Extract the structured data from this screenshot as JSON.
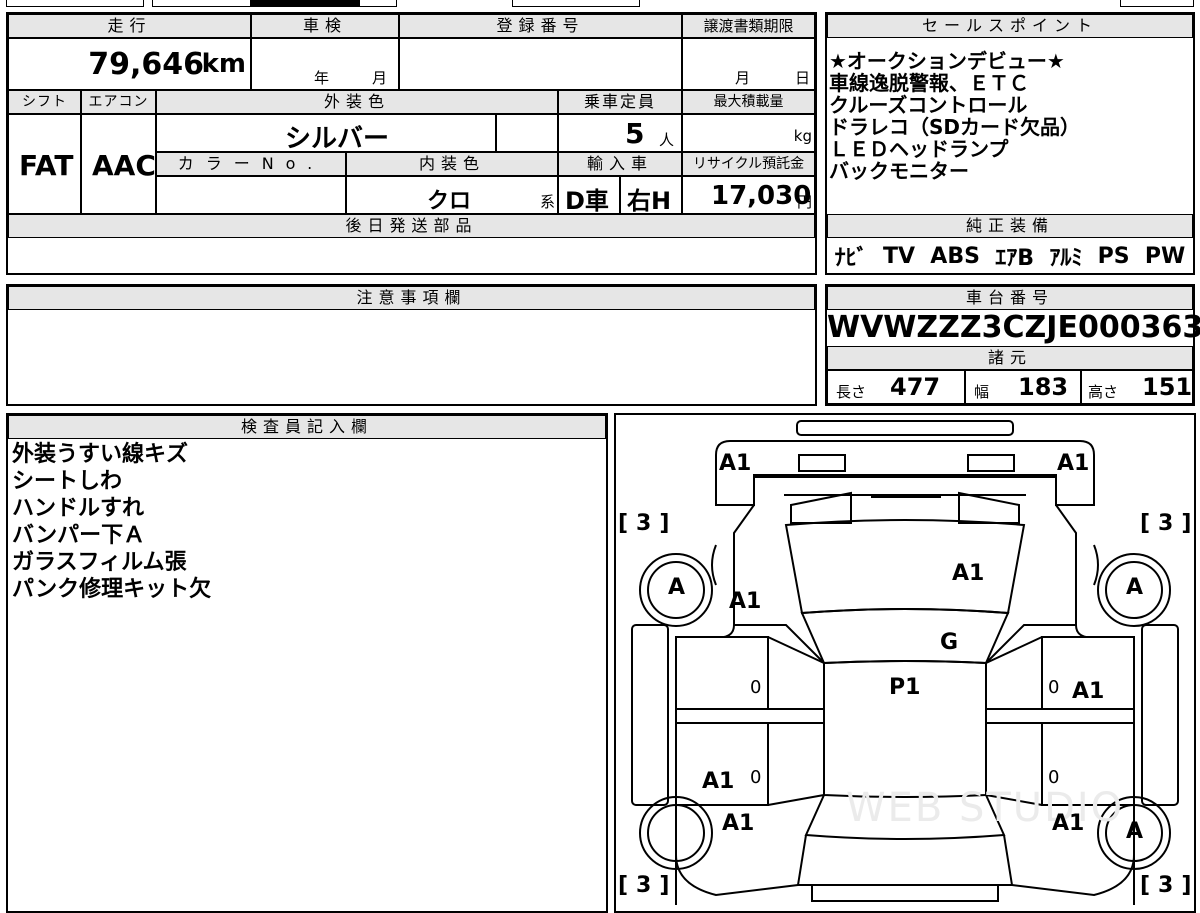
{
  "top_strip": {
    "fragment_1": "",
    "fragment_2": ""
  },
  "mileage": {
    "label": "走行",
    "value": "79,646",
    "unit": "km"
  },
  "inspection": {
    "label": "車検",
    "year_unit": "年",
    "month_unit": "月"
  },
  "registration": {
    "label": "登録番号",
    "value": ""
  },
  "transfer_deadline": {
    "label": "譲渡書類期限",
    "month_unit": "月",
    "day_unit": "日"
  },
  "shift": {
    "label": "シフト",
    "value": "FAT"
  },
  "aircon": {
    "label": "エアコン",
    "value": "AAC"
  },
  "exterior_color": {
    "label": "外装色",
    "value": "シルバー"
  },
  "capacity": {
    "label": "乗車定員",
    "value": "5",
    "unit": "人"
  },
  "max_load": {
    "label": "最大積載量",
    "unit": "kg"
  },
  "color_no": {
    "label": "カラーNo.",
    "value": ""
  },
  "interior_color": {
    "label": "内装色",
    "value": "クロ",
    "suffix": "系"
  },
  "import": {
    "label": "輸入車",
    "type": "D車",
    "steering": "右H"
  },
  "recycle": {
    "label": "リサイクル預託金",
    "value": "17,030",
    "unit": "円"
  },
  "later_parts": {
    "label": "後日発送部品",
    "value": ""
  },
  "caution": {
    "label": "注意事項欄",
    "value": ""
  },
  "sales_points": {
    "label": "セールスポイント",
    "lines": [
      "★オークションデビュー★",
      "車線逸脱警報、ＥＴＣ",
      "クルーズコントロール",
      "ドラレコ（SDカード欠品）",
      "ＬＥＤヘッドランプ",
      "バックモニター"
    ]
  },
  "factory_equipment": {
    "label": "純正装備",
    "items": [
      "ﾅﾋﾞ",
      "TV",
      "ABS",
      "ｴｱB",
      "ｱﾙﾐ",
      "PS",
      "PW"
    ]
  },
  "chassis": {
    "label": "車台番号",
    "value": "WVWZZZ3CZJE000363"
  },
  "specs": {
    "label": "諸元",
    "length_label": "長さ",
    "length": "477",
    "width_label": "幅",
    "width": "183",
    "height_label": "高さ",
    "height": "151"
  },
  "inspector": {
    "label": "検査員記入欄",
    "lines": [
      "外装うすい線キズ",
      "シートしわ",
      "ハンドルすれ",
      "バンパー下Ａ",
      "ガラスフィルム張",
      "パンク修理キット欠"
    ]
  },
  "diagram": {
    "marks": {
      "front_left": "A1",
      "front_right": "A1",
      "bracket_front_left": "[3]",
      "bracket_front_right": "[3]",
      "tire_front_left": "A",
      "tire_front_right": "A",
      "fender_left": "A1",
      "hood": "A1",
      "windshield": "G",
      "roof": "P1",
      "door_front_left": "0",
      "door_front_right": "0",
      "door_right_mark": "A1",
      "door_rear_left": "0",
      "door_rear_right": "0",
      "rear_left_upper": "A1",
      "rear_left_lower": "A1",
      "rear_right_lower": "A1",
      "tire_rear_right": "A",
      "bracket_rear_left": "[3]",
      "bracket_rear_right": "[3]"
    },
    "watermark": "WEB STUDIO"
  }
}
